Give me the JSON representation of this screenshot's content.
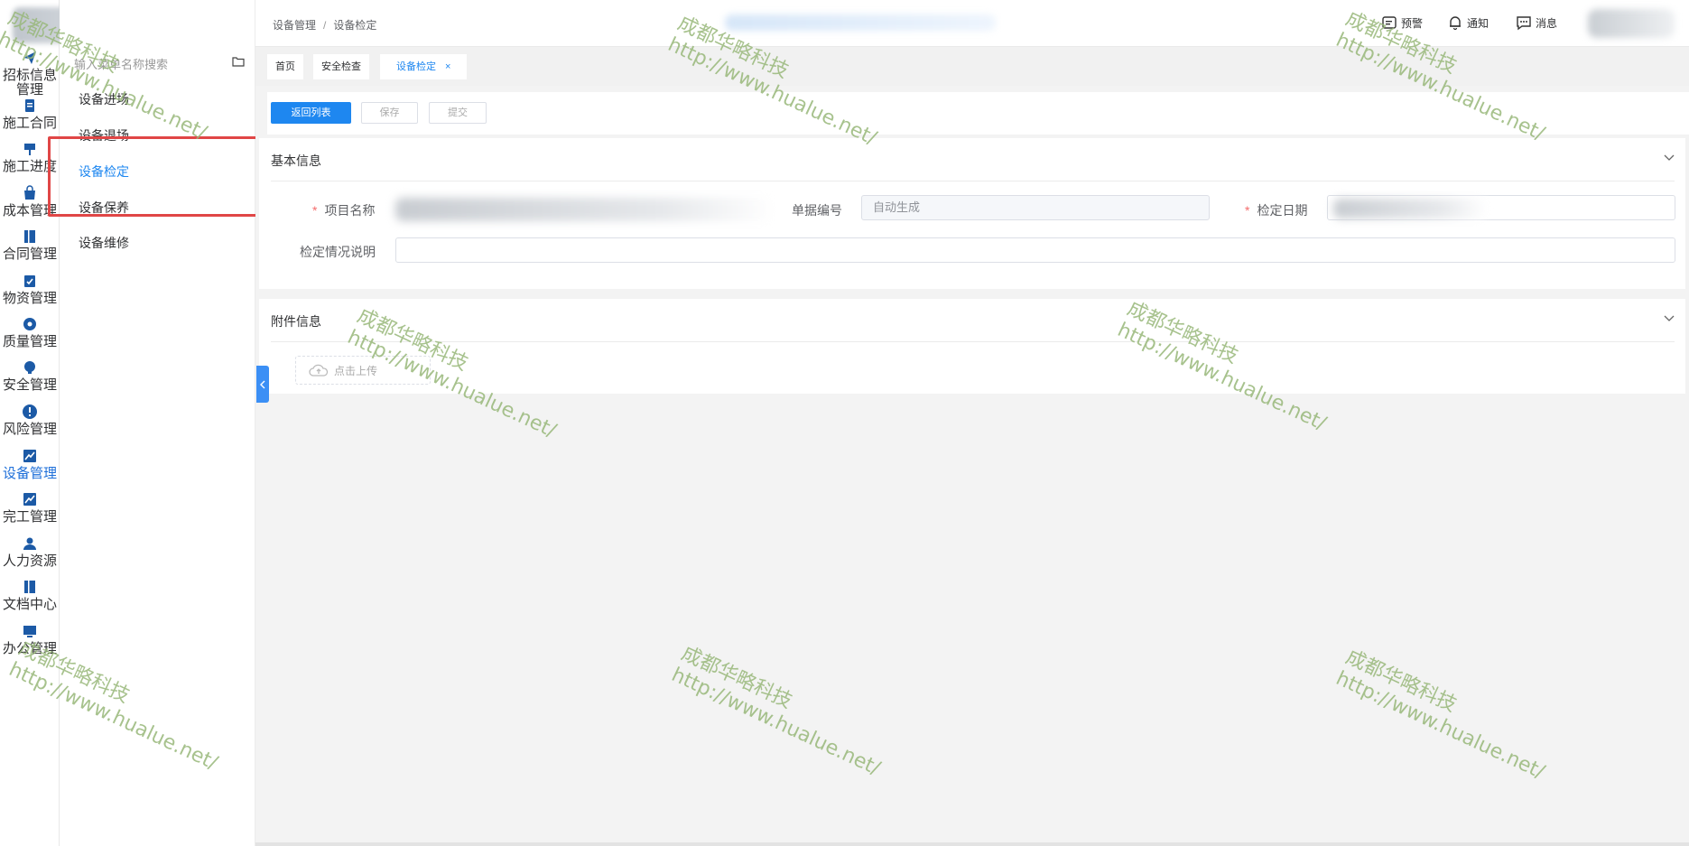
{
  "sidebar": {
    "items": [
      {
        "label": "招标信息管理",
        "icon": "send-icon"
      },
      {
        "label": "施工合同",
        "icon": "clipboard-icon"
      },
      {
        "label": "施工进度",
        "icon": "hammer-icon"
      },
      {
        "label": "成本管理",
        "icon": "bag-icon"
      },
      {
        "label": "合同管理",
        "icon": "book-icon"
      },
      {
        "label": "物资管理",
        "icon": "checklist-icon"
      },
      {
        "label": "质量管理",
        "icon": "compass-icon"
      },
      {
        "label": "安全管理",
        "icon": "bulb-icon"
      },
      {
        "label": "风险管理",
        "icon": "alert-icon"
      },
      {
        "label": "设备管理",
        "icon": "chart-icon"
      },
      {
        "label": "完工管理",
        "icon": "chart-icon"
      },
      {
        "label": "人力资源",
        "icon": "people-icon"
      },
      {
        "label": "文档中心",
        "icon": "book-icon"
      },
      {
        "label": "办公管理",
        "icon": "monitor-icon"
      }
    ],
    "active_index": 9
  },
  "submenu": {
    "search_placeholder": "输入菜单名称搜索",
    "items": [
      {
        "label": "设备进场"
      },
      {
        "label": "设备退场"
      },
      {
        "label": "设备检定"
      },
      {
        "label": "设备保养"
      },
      {
        "label": "设备维修"
      }
    ],
    "active_index": 2
  },
  "header": {
    "breadcrumb": [
      "设备管理",
      "设备检定"
    ],
    "breadcrumb_sep": "/",
    "actions": [
      {
        "label": "预警",
        "icon": "warning-list-icon"
      },
      {
        "label": "通知",
        "icon": "bell-icon"
      },
      {
        "label": "消息",
        "icon": "message-icon"
      }
    ]
  },
  "tabs": [
    {
      "label": "首页"
    },
    {
      "label": "安全检查"
    },
    {
      "label": "设备检定",
      "active": true,
      "close": "×"
    }
  ],
  "toolbar": {
    "back_label": "返回列表",
    "save_label": "保存",
    "submit_label": "提交"
  },
  "basic_info": {
    "title": "基本信息",
    "project_name_label": "项目名称",
    "doc_no_label": "单据编号",
    "doc_no_value": "自动生成",
    "check_date_label": "检定日期",
    "description_label": "检定情况说明",
    "required_mark": "*"
  },
  "attachments": {
    "title": "附件信息",
    "upload_label": "点击上传"
  },
  "watermark": {
    "line1": "成都华略科技",
    "line2": "http://www.hualue.net/"
  },
  "colors": {
    "primary": "#1e87f0",
    "highlight_box": "#e04646",
    "watermark": "#98b87a"
  }
}
